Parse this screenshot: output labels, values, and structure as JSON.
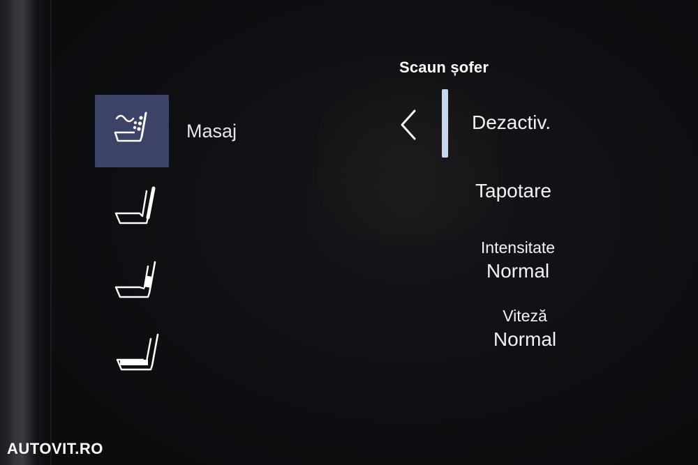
{
  "panel": {
    "title": "Scaun șofer"
  },
  "modes": {
    "selected_label": "Masaj",
    "items": [
      {
        "icon": "seat-massage-icon",
        "selected": true
      },
      {
        "icon": "seat-backrest-icon",
        "selected": false
      },
      {
        "icon": "seat-lumbar-icon",
        "selected": false
      },
      {
        "icon": "seat-cushion-icon",
        "selected": false
      }
    ]
  },
  "options": {
    "back_icon": "chevron-left-icon",
    "massage_state": "Dezactiv.",
    "program": "Tapotare",
    "intensity_label": "Intensitate",
    "intensity_value": "Normal",
    "speed_label": "Viteză",
    "speed_value": "Normal"
  },
  "watermark": {
    "text": "AUTOVIT.RO"
  },
  "colors": {
    "selected_tile": "#3d4366",
    "selection_bar": "#c9d6ef",
    "text": "#f2f3f5"
  }
}
